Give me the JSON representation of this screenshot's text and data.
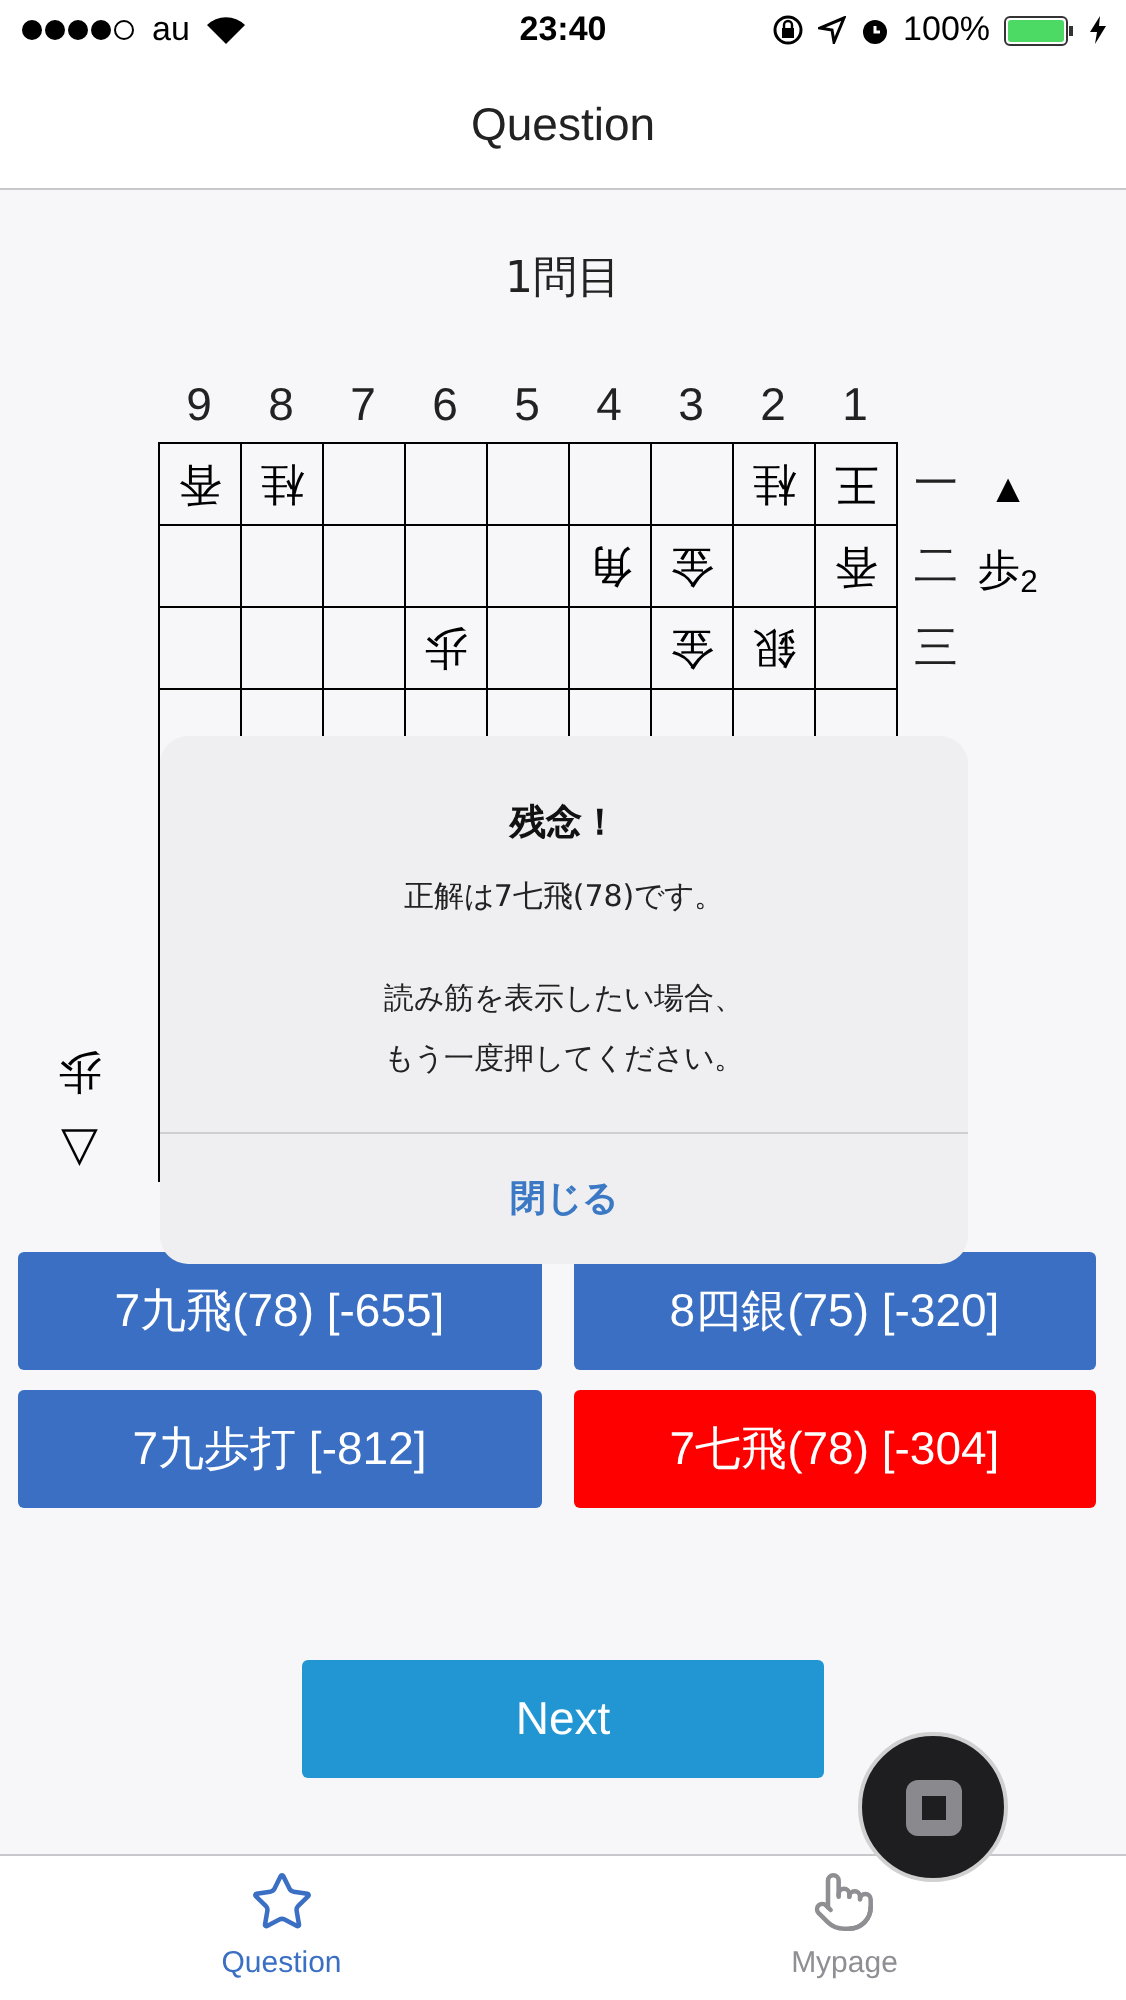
{
  "status_bar": {
    "carrier": "au",
    "time": "23:40",
    "battery": "100%"
  },
  "nav": {
    "title": "Question"
  },
  "question_number": "1問目",
  "board": {
    "files": [
      "9",
      "8",
      "7",
      "6",
      "5",
      "4",
      "3",
      "2",
      "1"
    ],
    "ranks": [
      "一",
      "二",
      "三"
    ],
    "rows": [
      [
        {
          "piece": "香",
          "flipped": true
        },
        {
          "piece": "桂",
          "flipped": true
        },
        null,
        null,
        null,
        null,
        null,
        {
          "piece": "桂",
          "flipped": true
        },
        {
          "piece": "王",
          "flipped": true
        }
      ],
      [
        null,
        null,
        null,
        null,
        null,
        {
          "piece": "角",
          "flipped": true
        },
        {
          "piece": "金",
          "flipped": true
        },
        null,
        {
          "piece": "香",
          "flipped": true
        }
      ],
      [
        null,
        null,
        null,
        {
          "piece": "歩",
          "flipped": true
        },
        null,
        null,
        {
          "piece": "金",
          "flipped": true
        },
        {
          "piece": "銀",
          "flipped": true
        },
        null
      ]
    ]
  },
  "sente_hand": {
    "mark": "▲",
    "pieces": "歩$_{2}$"
  },
  "gote_hand": {
    "mark": "▽",
    "pieces": "歩"
  },
  "answers": [
    {
      "label": "7九飛(78) [-655]",
      "correct": false
    },
    {
      "label": "8四銀(75) [-320]",
      "correct": false
    },
    {
      "label": "7九歩打 [-812]",
      "correct": false
    },
    {
      "label": "7七飛(78) [-304]",
      "correct": true
    }
  ],
  "next_button": "Next",
  "dialog": {
    "title": "残念！",
    "message": "正解は7七飛(78)です。",
    "hint_lines": [
      "読み筋を表示したい場合、",
      "もう一度押してください。"
    ],
    "button": "閉じる"
  },
  "tabs": [
    {
      "label": "Question",
      "selected": true
    },
    {
      "label": "Mypage",
      "selected": false
    }
  ]
}
